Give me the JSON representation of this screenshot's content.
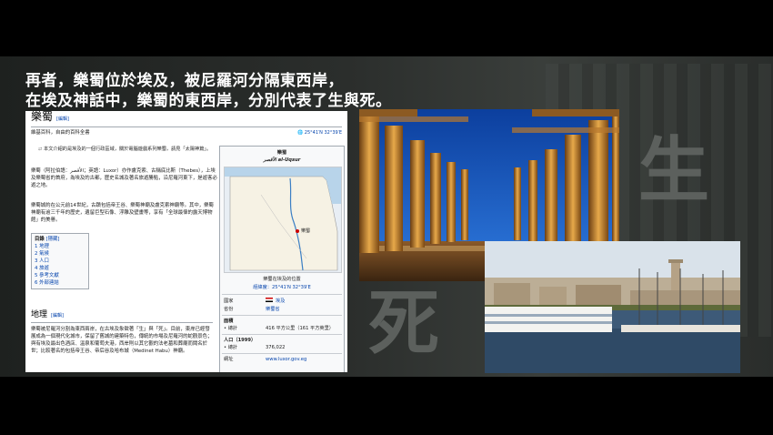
{
  "headline": {
    "line1": "再者，樂蜀位於埃及，被尼羅河分隔東西岸，",
    "line2": "在埃及神話中，樂蜀的東西岸，分別代表了生與死。"
  },
  "big_chars": {
    "life": "生",
    "death": "死"
  },
  "wiki": {
    "title": "樂蜀",
    "edit_label": "[編輯]",
    "coords": "25°41′N 32°39′E",
    "subtitle": "維基百科，自由的百科全書",
    "hatnote": "本文介紹的是埃及的一個行政區域，關於電腦遊戲系列樂蜀，請見「太陽神篇」。",
    "intro1": "樂蜀（阿拉伯語：الأقصر；英語：Luxor）亦作盧克索、古稱底比斯（Thebes），上埃及樂蜀省的首府，為埃及的古都，歷史名城及著名旅遊勝點，沿尼羅河東下，是遊客必遊之地。",
    "intro2": "樂蜀城約在公元前14世紀，古蹟包括帝王谷、樂蜀神廟及盧克索神廟等。其中，樂蜀神廟有逾三千年的歷史，遺留巨型石像、浮雕及壁畫等，享有「全球最偉的露天博物館」的美譽。",
    "toc": {
      "title": "目錄",
      "hide": "[隱藏]",
      "items": [
        "1 地理",
        "2 氣候",
        "3 人口",
        "4 旅遊",
        "5 參考文獻",
        "6 外部連結"
      ]
    },
    "section_title": "地理",
    "section_edit": "[編輯]",
    "geo": "樂蜀被尼羅河分割為東西兩岸，在古埃及象徵著「生」與「死」。目前，東岸已經發展成為一個現代化城市，保留了舊城的建築特色，傳統的市場及尼羅河的蛇觀景色；與有埃及最出色酒店、溫泉和葡萄夫港，西岸則以其它觀的法老墓和葬廟而聞名於世；比較著名的包括帝王谷、帝后谷及哈布城（Medinet Habu）神廟。",
    "infobox": {
      "name": "樂蜀",
      "name_ar": "الأقصر al-Uqsur",
      "map_label": "樂蜀",
      "caption": "樂蜀在埃及的位置",
      "coords": "經緯度：25°41′N 32°39′E",
      "country_k": "國家",
      "country_v": "埃及",
      "province_k": "省份",
      "province_v": "樂蜀省",
      "area_k": "面積",
      "area_total_k": "• 總計",
      "area_total_v": "416 平方公里（161 平方英里）",
      "pop_k": "人口（1999）",
      "pop_total_k": "• 總計",
      "pop_total_v": "376,022",
      "site_k": "網址",
      "site_v": "www.luxor.gov.eg"
    }
  },
  "colors": {
    "link": "#0645ad",
    "slide_bg": "#2b2e2c",
    "big_char": "#5c605d"
  }
}
